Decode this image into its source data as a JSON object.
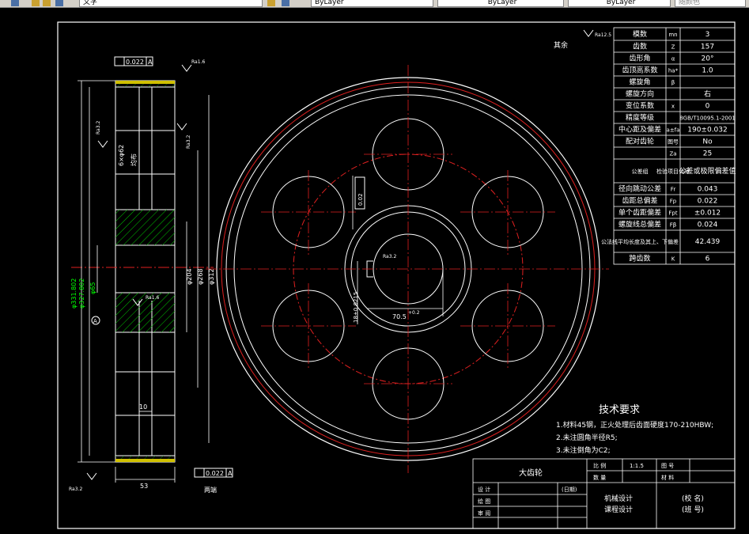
{
  "toolbar": {
    "text_style": "文字",
    "layer1": "ByLayer",
    "layer2": "ByLayer",
    "layer3": "ByLayer",
    "plot_style": "随颜色"
  },
  "roughness": {
    "other": "其余",
    "ra125": "Ra12.5",
    "ra16": "Ra1.6",
    "ra32": "Ra3.2"
  },
  "params": [
    [
      "模数",
      "mn",
      "3"
    ],
    [
      "齿数",
      "Z",
      "157"
    ],
    [
      "齿形角",
      "α",
      "20°"
    ],
    [
      "齿顶高系数",
      "ha*",
      "1.0"
    ],
    [
      "螺旋角",
      "β",
      ""
    ],
    [
      "螺旋方向",
      "",
      "右"
    ],
    [
      "变位系数",
      "x",
      "0"
    ],
    [
      "精度等级",
      "",
      "8GB/T10095.1-2001"
    ],
    [
      "中心距及偏差",
      "a±fa",
      "190±0.032"
    ],
    [
      "配对齿轮",
      "图号",
      "No"
    ],
    [
      "",
      "齿数",
      "Za",
      "25"
    ],
    [
      "公差组",
      "检验项目代号",
      "公差或极限偏差值"
    ],
    [
      "径向跳动公差",
      "Fr",
      "0.043"
    ],
    [
      "齿距总偏差",
      "Fp",
      "0.022"
    ],
    [
      "单个齿距偏差",
      "Fpt",
      "±0.012"
    ],
    [
      "螺旋线总偏差",
      "Fβ",
      "0.024"
    ],
    [
      "公法线平均长度及其上、下偏差",
      "",
      "42.439"
    ],
    [
      "跨齿数",
      "K",
      "6"
    ]
  ],
  "tech": {
    "title": "技术要求",
    "lines": [
      "1.材料45钢，正火处理后齿面硬度170-210HBW;",
      "2.未注圆角半径R5;",
      "3.未注倒角为C2;"
    ]
  },
  "title_block": {
    "part_name": "大齿轮",
    "scale_label": "比 例",
    "scale_value": "1:1.5",
    "qty_label": "数 量",
    "drawing_no_label": "图 号",
    "material_label": "材 料",
    "design": "设 计",
    "check": "绘 图",
    "review": "审 阅",
    "date": "(日期)",
    "course": "机械设计",
    "course2": "课程设计",
    "school": "(校 名)",
    "class": "(班 号)"
  },
  "dims": {
    "d_tip": "φ331.802",
    "d_tip_tol": "-0.2900",
    "d_root": "φ327.802",
    "d_hub": "φ65",
    "d_hub_tol": "+0.030",
    "d204": "φ204",
    "d268": "φ268",
    "d312": "φ312",
    "d6x96": "6×φ62",
    "equal": "均布",
    "width": "53",
    "web": "10",
    "both_ends": "两端",
    "runout": "0.022",
    "datum": "A",
    "keyway": "18±0.0215",
    "keydepth": "70.5",
    "keytol": "+0.2",
    "sym": "0.02",
    "datum_a": "A"
  }
}
